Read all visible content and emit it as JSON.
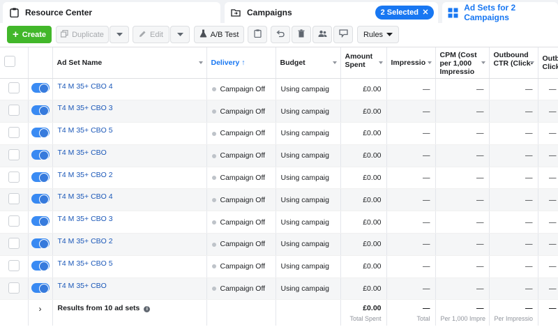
{
  "tabs": {
    "resource_center": "Resource Center",
    "campaigns": "Campaigns",
    "selected_badge": "2 Selected",
    "ad_sets": "Ad Sets for 2 Campaigns"
  },
  "toolbar": {
    "create": "Create",
    "duplicate": "Duplicate",
    "edit": "Edit",
    "ab_test": "A/B Test",
    "rules": "Rules"
  },
  "columns": {
    "name": "Ad Set Name",
    "delivery": "Delivery",
    "budget": "Budget",
    "amount_spent": "Amount Spent",
    "impressions": "Impressio",
    "cpm": "CPM (Cost per 1,000 Impressio",
    "outbound_ctr": "Outbound CTR (Click-",
    "outbound_clicks": "Outbo Click"
  },
  "rows": [
    {
      "name": "T4 M 35+ CBO 4",
      "delivery": "Campaign Off",
      "budget": "Using campaig",
      "spent": "£0.00",
      "impr": "—",
      "cpm": "—",
      "ctr": "—",
      "clicks": "—"
    },
    {
      "name": "T4 M 35+ CBO 3",
      "delivery": "Campaign Off",
      "budget": "Using campaig",
      "spent": "£0.00",
      "impr": "—",
      "cpm": "—",
      "ctr": "—",
      "clicks": "—"
    },
    {
      "name": "T4 M 35+ CBO 5",
      "delivery": "Campaign Off",
      "budget": "Using campaig",
      "spent": "£0.00",
      "impr": "—",
      "cpm": "—",
      "ctr": "—",
      "clicks": "—"
    },
    {
      "name": "T4 M 35+ CBO",
      "delivery": "Campaign Off",
      "budget": "Using campaig",
      "spent": "£0.00",
      "impr": "—",
      "cpm": "—",
      "ctr": "—",
      "clicks": "—"
    },
    {
      "name": "T4 M 35+ CBO 2",
      "delivery": "Campaign Off",
      "budget": "Using campaig",
      "spent": "£0.00",
      "impr": "—",
      "cpm": "—",
      "ctr": "—",
      "clicks": "—"
    },
    {
      "name": "T4 M 35+ CBO 4",
      "delivery": "Campaign Off",
      "budget": "Using campaig",
      "spent": "£0.00",
      "impr": "—",
      "cpm": "—",
      "ctr": "—",
      "clicks": "—"
    },
    {
      "name": "T4 M 35+ CBO 3",
      "delivery": "Campaign Off",
      "budget": "Using campaig",
      "spent": "£0.00",
      "impr": "—",
      "cpm": "—",
      "ctr": "—",
      "clicks": "—"
    },
    {
      "name": "T4 M 35+ CBO 2",
      "delivery": "Campaign Off",
      "budget": "Using campaig",
      "spent": "£0.00",
      "impr": "—",
      "cpm": "—",
      "ctr": "—",
      "clicks": "—"
    },
    {
      "name": "T4 M 35+ CBO 5",
      "delivery": "Campaign Off",
      "budget": "Using campaig",
      "spent": "£0.00",
      "impr": "—",
      "cpm": "—",
      "ctr": "—",
      "clicks": "—"
    },
    {
      "name": "T4 M 35+ CBO",
      "delivery": "Campaign Off",
      "budget": "Using campaig",
      "spent": "£0.00",
      "impr": "—",
      "cpm": "—",
      "ctr": "—",
      "clicks": "—"
    }
  ],
  "footer": {
    "results": "Results from 10 ad sets",
    "spent": "£0.00",
    "spent_sub": "Total Spent",
    "impr": "—",
    "impr_sub": "Total",
    "cpm": "—",
    "cpm_sub": "Per 1,000 Impre",
    "ctr": "—",
    "ctr_sub": "Per Impressio",
    "clicks": "—"
  },
  "colors": {
    "accent": "#1877f2",
    "create_green": "#42b72a"
  }
}
